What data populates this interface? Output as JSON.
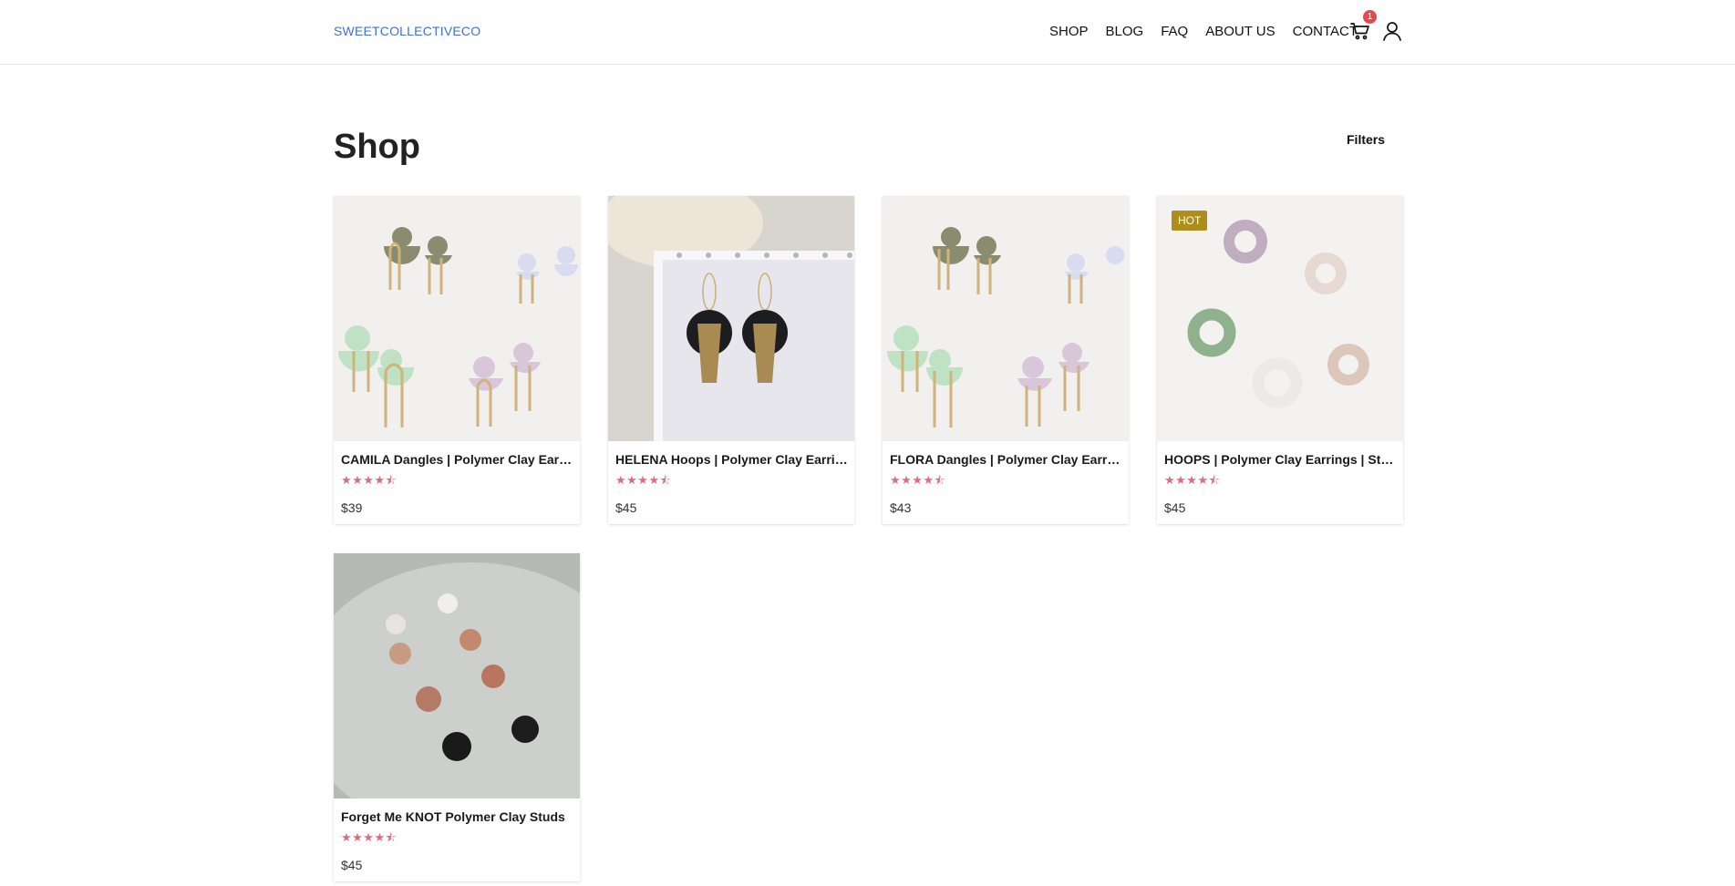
{
  "header": {
    "logo": "SWEETCOLLECTIVECO",
    "nav": [
      "SHOP",
      "BLOG",
      "FAQ",
      "ABOUT US",
      "CONTACT"
    ],
    "cart_count": "1",
    "icons": [
      "cart-icon",
      "user-icon"
    ]
  },
  "main": {
    "title": "Shop",
    "filters_label": "Filters"
  },
  "products": [
    {
      "name": "CAMILA Dangles | Polymer Clay Earrings",
      "stars": "★★★★⯪",
      "price": "$39",
      "badge": ""
    },
    {
      "name": "HELENA Hoops | Polymer Clay Earrings",
      "stars": "★★★★⯪",
      "price": "$45",
      "badge": ""
    },
    {
      "name": "FLORA Dangles | Polymer Clay Earrings",
      "stars": "★★★★⯪",
      "price": "$43",
      "badge": ""
    },
    {
      "name": "HOOPS | Polymer Clay Earrings | Statement",
      "stars": "★★★★⯪",
      "price": "$45",
      "badge": "HOT"
    },
    {
      "name": "Forget Me KNOT Polymer Clay Studs",
      "stars": "★★★★⯪",
      "price": "$45",
      "badge": ""
    }
  ],
  "colors": {
    "logo": "#3f6fe0",
    "stars": "#e06b7b",
    "hot_badge": "#ad8e1a",
    "cart_badge": "#e5484d"
  }
}
